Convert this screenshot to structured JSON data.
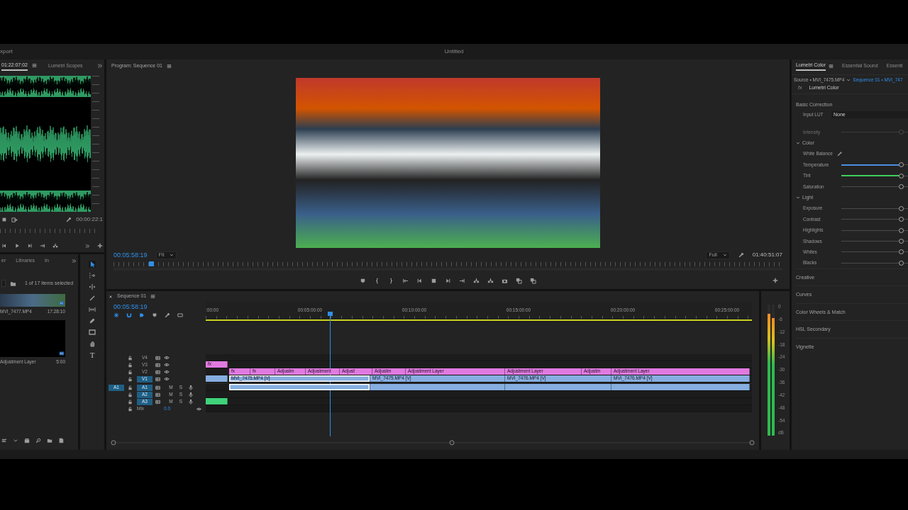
{
  "app": {
    "menu_item": "xport",
    "title": "Untitled"
  },
  "source_monitor": {
    "tabs": [
      {
        "label": "01:22:07:02",
        "selected": true
      },
      {
        "label": "Lumetri Scopes",
        "selected": false
      }
    ],
    "timecode": "00:00:22:1"
  },
  "program_monitor": {
    "title": "Program: Sequence 01",
    "timecode": "00:05:58:19",
    "zoom": "Fit",
    "quality": "Full",
    "duration": "01:40:51:07",
    "playhead": {
      "level": 0.056
    }
  },
  "project_panel": {
    "tabs": [
      "er",
      "Libraries",
      "In"
    ],
    "status": "1 of 17 items selected",
    "items": [
      {
        "kind": "video",
        "name": "MVI_7477.MP4",
        "duration": "17:28:10"
      },
      {
        "kind": "adjustment",
        "name": "Adjustment Layer",
        "duration": "5:00"
      }
    ]
  },
  "tools": [
    {
      "kind": "selection",
      "selected": true
    },
    {
      "kind": "track-select",
      "selected": false
    },
    {
      "kind": "ripple",
      "selected": false
    },
    {
      "kind": "razor",
      "selected": false
    },
    {
      "kind": "slip",
      "selected": false
    },
    {
      "kind": "pen",
      "selected": false
    },
    {
      "kind": "rectangle",
      "selected": false
    },
    {
      "kind": "hand",
      "selected": false
    },
    {
      "kind": "type",
      "glyph": "T",
      "selected": false
    }
  ],
  "timeline": {
    "title": "Sequence 01",
    "timecode": "00:05:58:19",
    "ruler": [
      ":00:00",
      "00:05:00:00",
      "00:10:00:00",
      "00:15:00:00",
      "00:20:00:00",
      "00:25:00:00"
    ],
    "playhead": {
      "level": 0.227
    },
    "tracks": [
      {
        "kind": "video",
        "label": "V4",
        "targeted": false
      },
      {
        "kind": "video",
        "label": "V3",
        "targeted": false,
        "clips": [
          {
            "label": "fx",
            "color": "#e07ae0",
            "selected": false
          }
        ]
      },
      {
        "kind": "video",
        "label": "V2",
        "targeted": false,
        "clips": [
          {
            "label": "fx",
            "color": "#e07ae0",
            "selected": false
          },
          {
            "label": "fx",
            "color": "#e07ae0",
            "selected": false
          },
          {
            "label": "Adjustm",
            "color": "#e07ae0",
            "selected": false
          },
          {
            "label": "Adjustment",
            "color": "#e07ae0",
            "selected": false
          },
          {
            "label": "Adjust",
            "color": "#e07ae0",
            "selected": false
          },
          {
            "label": "Adjustm",
            "color": "#e07ae0",
            "selected": false
          },
          {
            "label": "Adjustment Layer",
            "color": "#e07ae0",
            "selected": false
          },
          {
            "label": "Adjustment Layer",
            "color": "#e07ae0",
            "selected": false
          },
          {
            "label": "Adjustm",
            "color": "#e07ae0",
            "selected": false
          },
          {
            "label": "Adjustment Layer",
            "color": "#e07ae0",
            "selected": false
          }
        ]
      },
      {
        "kind": "video",
        "label": "V1",
        "targeted": true,
        "clips": [
          {
            "color": "#86aee0",
            "selected": false
          },
          {
            "label": "MVI_7475.MP4 [V]",
            "color": "#86aee0",
            "selected": true
          },
          {
            "label": "MVI_7475.MP4 [V]",
            "color": "#86aee0",
            "selected": false
          },
          {
            "label": "MVI_7476.MP4 [V]",
            "color": "#86aee0",
            "selected": false
          },
          {
            "label": "MVI_7476.MP4 [V]",
            "color": "#86aee0",
            "selected": false
          }
        ]
      },
      {
        "kind": "audio",
        "label": "A1",
        "source_patch": "A1",
        "targeted": true,
        "mute": "M",
        "solo": "S",
        "clips": [
          {
            "color": "#86aee0",
            "selected": true
          },
          {
            "color": "#86aee0",
            "selected": false
          },
          {
            "color": "#86aee0",
            "selected": false
          },
          {
            "color": "#86aee0",
            "selected": false
          }
        ]
      },
      {
        "kind": "audio",
        "label": "A2",
        "targeted": true,
        "mute": "M",
        "solo": "S"
      },
      {
        "kind": "audio",
        "label": "A3",
        "targeted": true,
        "mute": "M",
        "solo": "S",
        "clips": [
          {
            "color": "#3fd27a",
            "selected": false
          }
        ]
      },
      {
        "kind": "mix",
        "label": "Mix",
        "value": "0.0"
      }
    ]
  },
  "audio_meter": {
    "channels": [
      {
        "level": 0.93
      },
      {
        "level": 0.9
      }
    ],
    "scale": [
      "0",
      "-6",
      "-12",
      "-18",
      "-24",
      "-30",
      "-36",
      "-42",
      "-48",
      "-54",
      "dB"
    ]
  },
  "lumetri": {
    "tabs": [
      {
        "label": "Lumetri Color",
        "selected": true
      },
      {
        "label": "Essential Sound",
        "selected": false
      },
      {
        "label": "Essenti",
        "selected": false
      }
    ],
    "source": "Source • MVI_7475.MP4",
    "sequence": "Sequence 01 • MVI_747",
    "effect_badge": "fx",
    "effect": "Lumetri Color",
    "sections": [
      {
        "title": "Basic Correction",
        "input_lut": {
          "label": "Input LUT",
          "value": "None"
        },
        "intensity": {
          "label": "Intensity",
          "level": 0.9,
          "disabled": true
        },
        "groups": [
          {
            "title": "Color",
            "expanded": true,
            "white_balance": "White Balance",
            "sliders": [
              {
                "label": "Temperature",
                "level": 0.9,
                "color": "#4a8fe0"
              },
              {
                "label": "Tint",
                "level": 0.9,
                "color": "#3fcf5a"
              },
              {
                "label": "Saturation",
                "level": 0.9
              }
            ]
          },
          {
            "title": "Light",
            "expanded": true,
            "sliders": [
              {
                "label": "Exposure",
                "level": 0.9
              },
              {
                "label": "Contrast",
                "level": 0.9
              },
              {
                "label": "Highlights",
                "level": 0.9
              },
              {
                "label": "Shadows",
                "level": 0.9
              },
              {
                "label": "Whites",
                "level": 0.9
              },
              {
                "label": "Blacks",
                "level": 0.9
              }
            ]
          }
        ]
      },
      {
        "title": "Creative"
      },
      {
        "title": "Curves"
      },
      {
        "title": "Color Wheels & Match"
      },
      {
        "title": "HSL Secondary"
      },
      {
        "title": "Vignette"
      }
    ]
  }
}
